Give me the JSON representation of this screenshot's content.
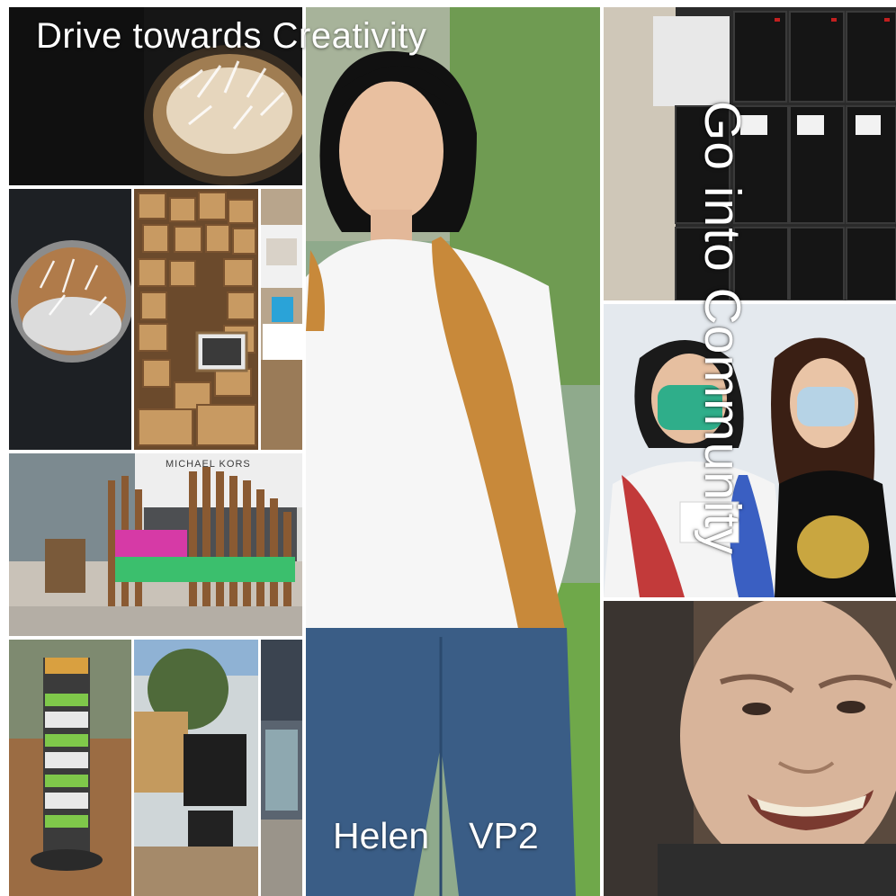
{
  "headline": "Drive towards Creativity",
  "caption": {
    "name": "Helen",
    "role": "VP2"
  },
  "vertical_text": "Go into Community",
  "storefront_sign": "MICHAEL KORS",
  "colors": {
    "border": "#ffffff",
    "text": "#ffffff",
    "wood": "#b88a58",
    "jeans": "#3a5d86",
    "scarf": "#c8893a",
    "mask_green": "#2fae8a",
    "mask_blue": "#b6d3e6",
    "grass": "#6fa84a"
  }
}
